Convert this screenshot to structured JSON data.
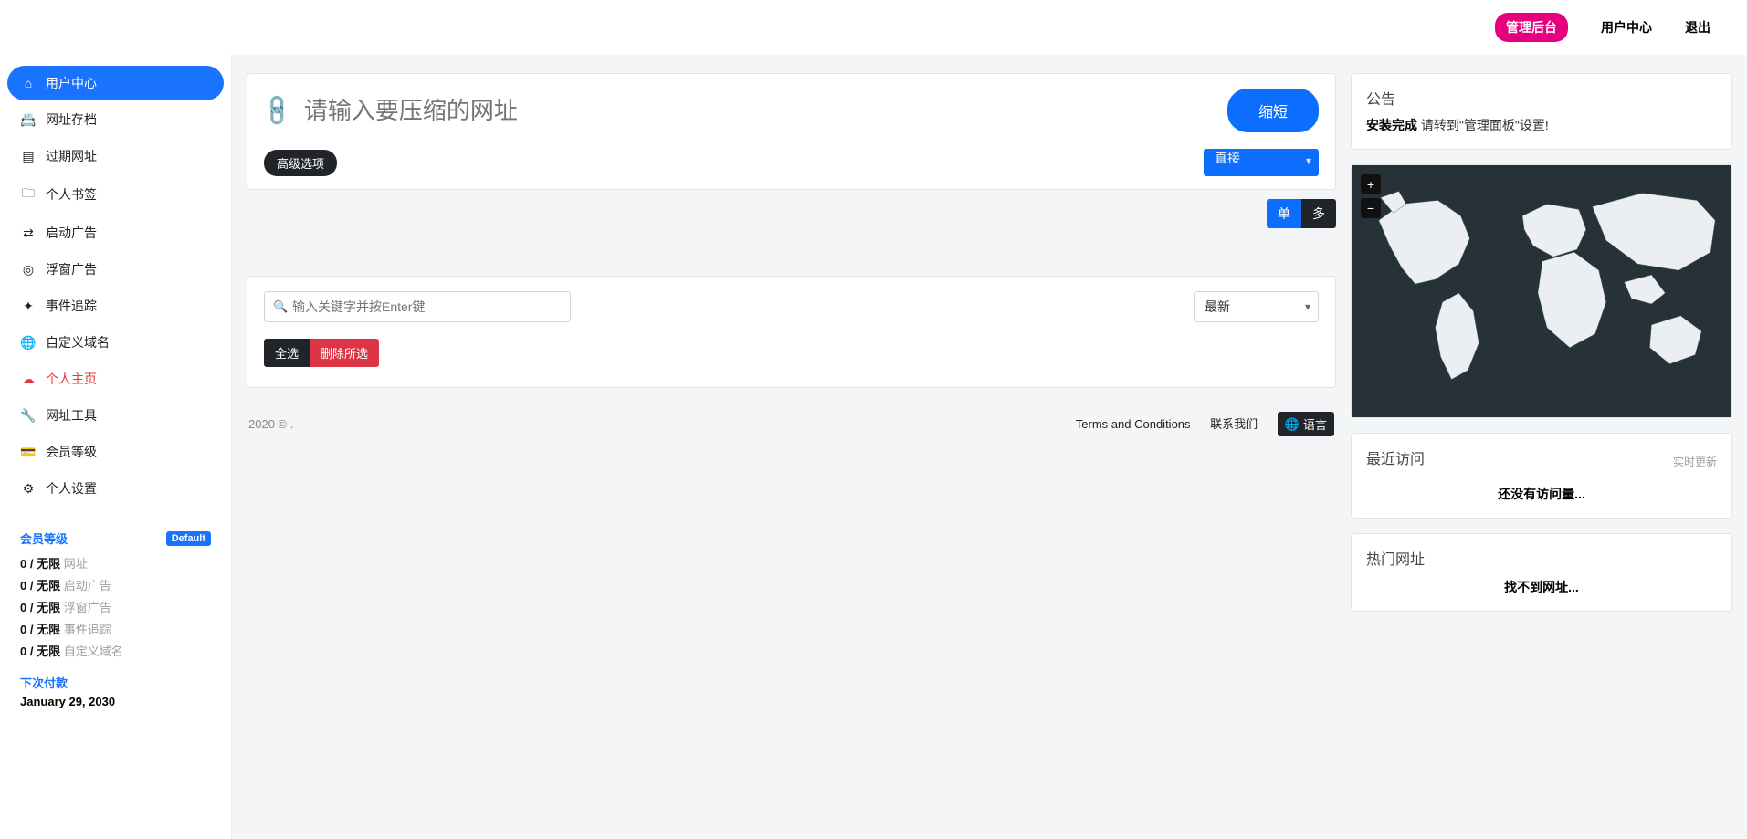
{
  "topnav": {
    "admin": "管理后台",
    "user_center": "用户中心",
    "logout": "退出"
  },
  "sidebar": {
    "items": [
      {
        "icon": "home-icon",
        "glyph": "⌂",
        "label": "用户中心",
        "active": true,
        "cloud": false
      },
      {
        "icon": "archive-icon",
        "glyph": "📇",
        "label": "网址存档",
        "active": false,
        "cloud": false
      },
      {
        "icon": "expired-icon",
        "glyph": "▤",
        "label": "过期网址",
        "active": false,
        "cloud": false
      },
      {
        "icon": "bookmark-icon",
        "glyph": "🗀",
        "label": "个人书签",
        "active": false,
        "cloud": false
      },
      {
        "icon": "splash-icon",
        "glyph": "⇄",
        "label": "启动广告",
        "active": false,
        "cloud": false
      },
      {
        "icon": "overlay-icon",
        "glyph": "◎",
        "label": "浮窗广告",
        "active": false,
        "cloud": false
      },
      {
        "icon": "pixel-icon",
        "glyph": "✦",
        "label": "事件追踪",
        "active": false,
        "cloud": false
      },
      {
        "icon": "domain-icon",
        "glyph": "🌐",
        "label": "自定义域名",
        "active": false,
        "cloud": false
      },
      {
        "icon": "cloud-icon",
        "glyph": "☁",
        "label": "个人主页",
        "active": false,
        "cloud": true
      },
      {
        "icon": "tools-icon",
        "glyph": "🔧",
        "label": "网址工具",
        "active": false,
        "cloud": false
      },
      {
        "icon": "tier-icon",
        "glyph": "💳",
        "label": "会员等级",
        "active": false,
        "cloud": false
      },
      {
        "icon": "settings-icon",
        "glyph": "⚙",
        "label": "个人设置",
        "active": false,
        "cloud": false
      }
    ],
    "plan": {
      "heading": "会员等级",
      "tag": "Default",
      "stats": [
        {
          "count": "0 / 无限",
          "name": "网址"
        },
        {
          "count": "0 / 无限",
          "name": "启动广告"
        },
        {
          "count": "0 / 无限",
          "name": "浮窗广告"
        },
        {
          "count": "0 / 无限",
          "name": "事件追踪"
        },
        {
          "count": "0 / 无限",
          "name": "自定义域名"
        }
      ],
      "next_pay_label": "下次付款",
      "next_pay_date": "January 29, 2030"
    }
  },
  "shorten": {
    "placeholder": "请输入要压缩的网址",
    "button": "缩短",
    "advanced_label": "高级选项",
    "redirect_select": "直接",
    "toggle_single": "单",
    "toggle_multi": "多"
  },
  "list": {
    "search_placeholder": "输入关键字并按Enter键",
    "sort_select": "最新",
    "select_all": "全选",
    "delete_selected": "删除所选"
  },
  "right": {
    "announce_title": "公告",
    "announce_bold": "安装完成",
    "announce_rest": " 请转到\"管理面板\"设置!",
    "recent_title": "最近访问",
    "recent_live": "实时更新",
    "recent_empty": "还没有访问量...",
    "popular_title": "热门网址",
    "popular_empty": "找不到网址..."
  },
  "footer": {
    "copyright": "2020 © .",
    "terms": "Terms and Conditions",
    "contact": "联系我们",
    "language": "语言"
  }
}
